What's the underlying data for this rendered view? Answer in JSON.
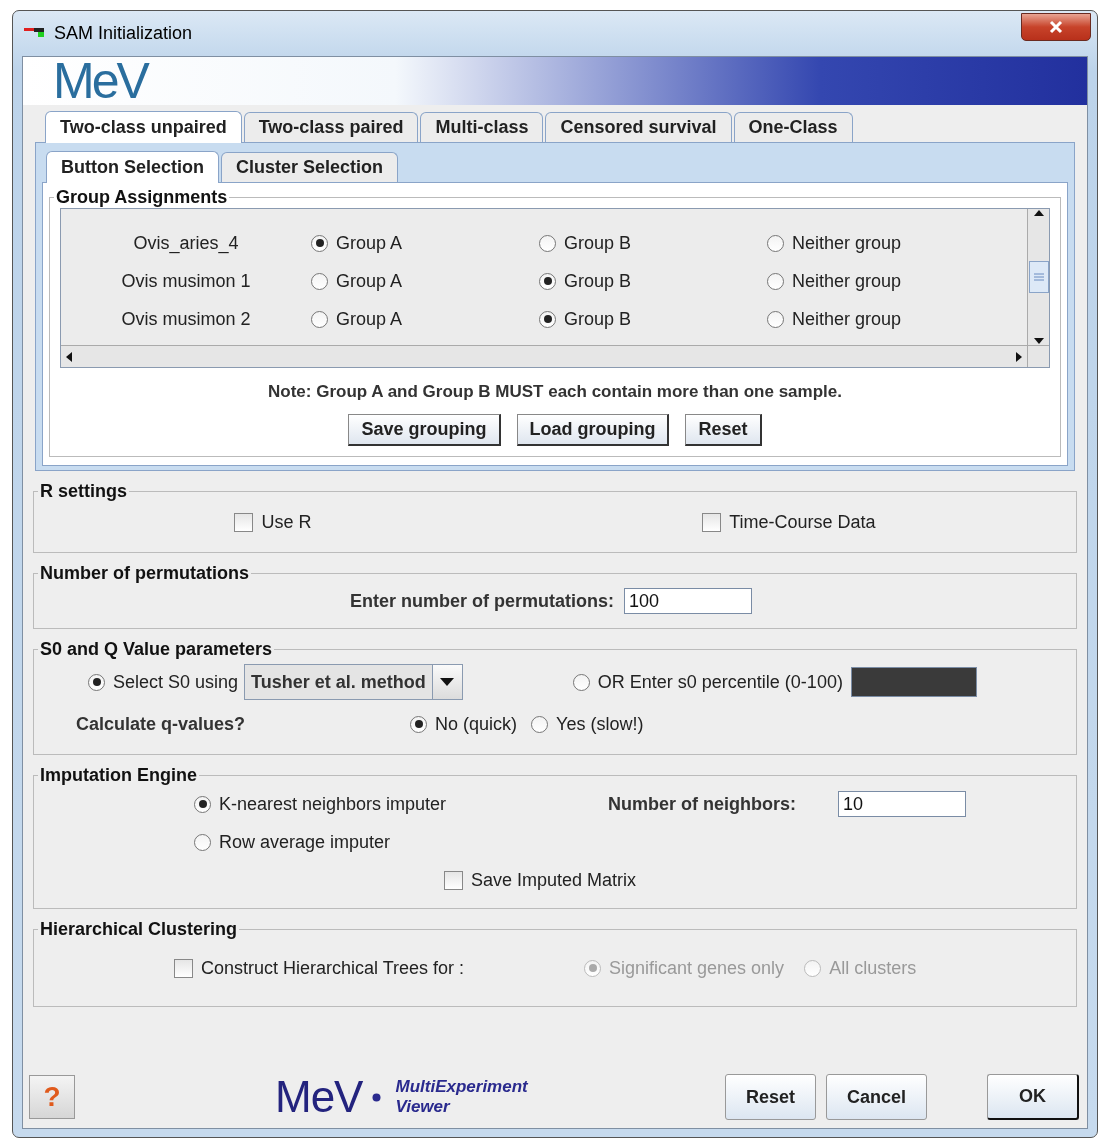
{
  "window": {
    "title": "SAM Initialization"
  },
  "banner": {
    "logo": "MeV"
  },
  "tabs": [
    {
      "label": "Two-class unpaired",
      "selected": true
    },
    {
      "label": "Two-class paired",
      "selected": false
    },
    {
      "label": "Multi-class",
      "selected": false
    },
    {
      "label": "Censored survival",
      "selected": false
    },
    {
      "label": "One-Class",
      "selected": false
    }
  ],
  "subtabs": [
    {
      "label": "Button Selection",
      "selected": true
    },
    {
      "label": "Cluster Selection",
      "selected": false
    }
  ],
  "group_assignments": {
    "title": "Group Assignments",
    "rows": [
      {
        "name": "Ovis_aries_4",
        "options": [
          {
            "label": "Group A",
            "selected": true
          },
          {
            "label": "Group B",
            "selected": false
          },
          {
            "label": "Neither group",
            "selected": false
          }
        ]
      },
      {
        "name": "Ovis musimon 1",
        "options": [
          {
            "label": "Group A",
            "selected": false
          },
          {
            "label": "Group B",
            "selected": true
          },
          {
            "label": "Neither group",
            "selected": false
          }
        ]
      },
      {
        "name": "Ovis musimon 2",
        "options": [
          {
            "label": "Group A",
            "selected": false
          },
          {
            "label": "Group B",
            "selected": true
          },
          {
            "label": "Neither group",
            "selected": false
          }
        ]
      }
    ],
    "note": "Note: Group A and Group B  MUST each contain more than one sample.",
    "buttons": [
      "Save grouping",
      "Load grouping",
      "Reset"
    ]
  },
  "r_settings": {
    "title": "R settings",
    "options": [
      {
        "label": "Use R",
        "checked": false
      },
      {
        "label": "Time-Course Data",
        "checked": false
      }
    ]
  },
  "permutations": {
    "title": "Number of permutations",
    "label": "Enter number of permutations:",
    "value": "100"
  },
  "s0": {
    "title": "S0 and Q Value parameters",
    "s0_options": [
      {
        "kind": "dropdown",
        "label": "Select S0 using",
        "value": "Tusher et al. method",
        "selected": true
      },
      {
        "kind": "field",
        "label": "OR Enter s0 percentile (0-100)",
        "selected": false,
        "disabled": true
      }
    ],
    "q_label": "Calculate q-values?",
    "q_options": [
      {
        "label": "No (quick)",
        "selected": true
      },
      {
        "label": "Yes (slow!)",
        "selected": false
      }
    ]
  },
  "imputation": {
    "title": "Imputation Engine",
    "engines": [
      {
        "label": "K-nearest neighbors imputer",
        "selected": true
      },
      {
        "label": "Row average imputer",
        "selected": false
      }
    ],
    "neighbors_label": "Number of neighbors:",
    "neighbors_value": "10",
    "save_matrix": {
      "label": "Save Imputed Matrix",
      "checked": false
    }
  },
  "hierarchical": {
    "title": "Hierarchical Clustering",
    "construct": {
      "label": "Construct Hierarchical Trees for :",
      "checked": false
    },
    "options": [
      {
        "label": "Significant genes only",
        "selected": true,
        "disabled": true
      },
      {
        "label": "All clusters",
        "selected": false,
        "disabled": true
      }
    ]
  },
  "footer": {
    "help": "?",
    "logo": "MeV",
    "tagline_1": "MultiExperiment",
    "tagline_2": "Viewer",
    "buttons": [
      "Reset",
      "Cancel",
      "OK"
    ]
  }
}
